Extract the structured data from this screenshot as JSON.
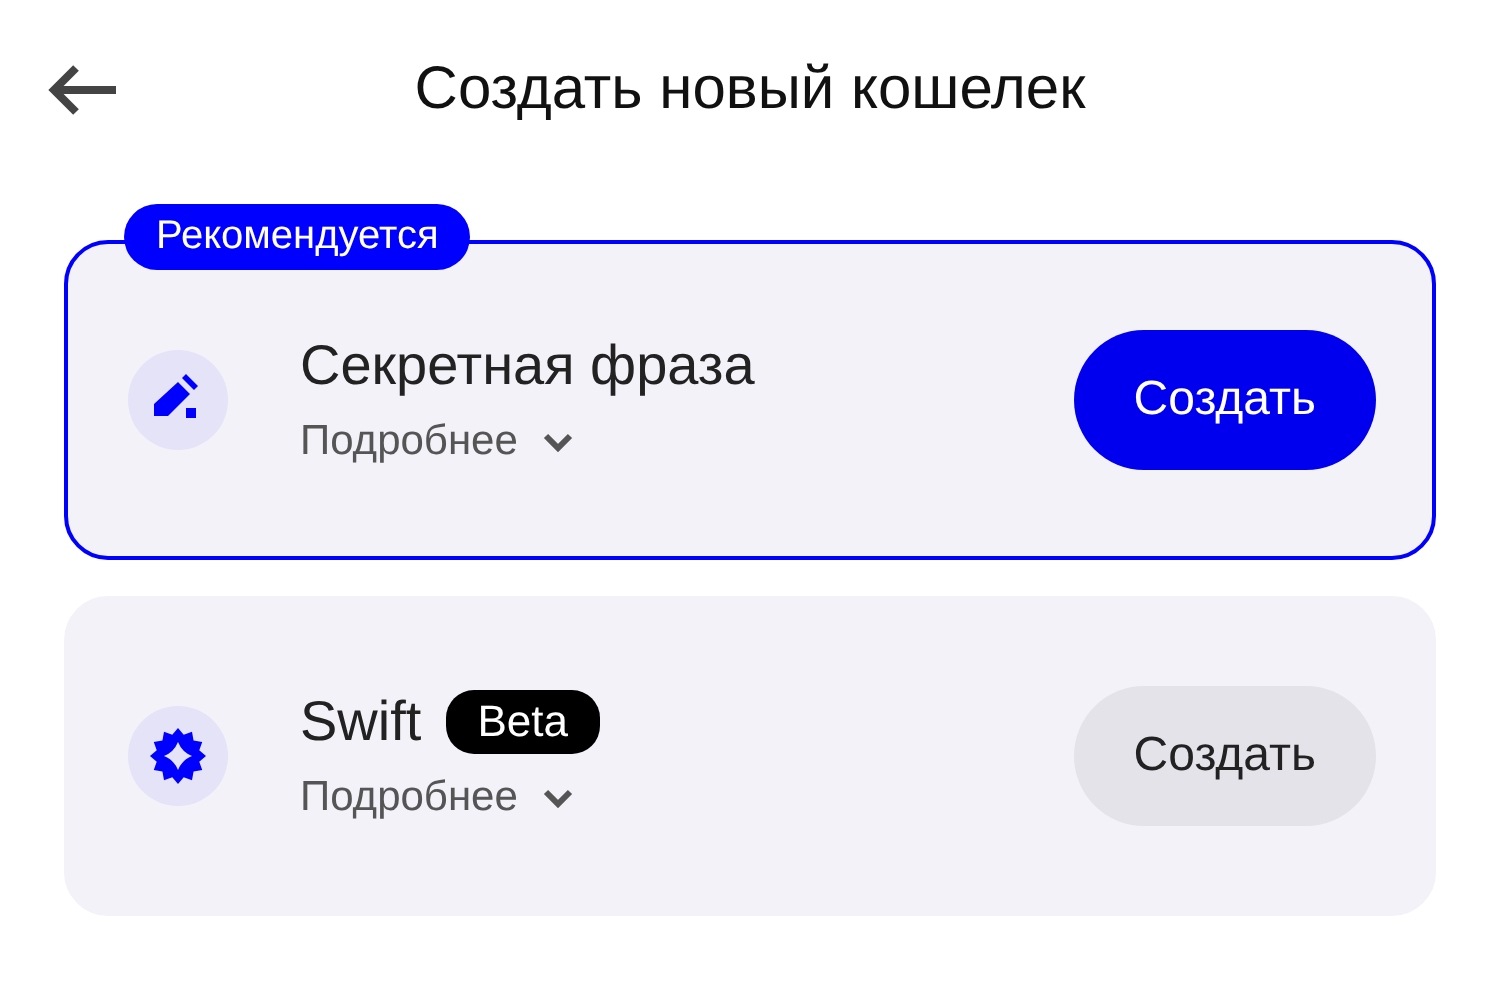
{
  "header": {
    "title": "Создать новый кошелек"
  },
  "options": [
    {
      "kind": "phrase",
      "badge": "Рекомендуется",
      "title": "Секретная фраза",
      "details": "Подробнее",
      "button": "Создать",
      "selected": true
    },
    {
      "kind": "swift",
      "tag": "Beta",
      "title": "Swift",
      "details": "Подробнее",
      "button": "Создать",
      "selected": false
    }
  ]
}
